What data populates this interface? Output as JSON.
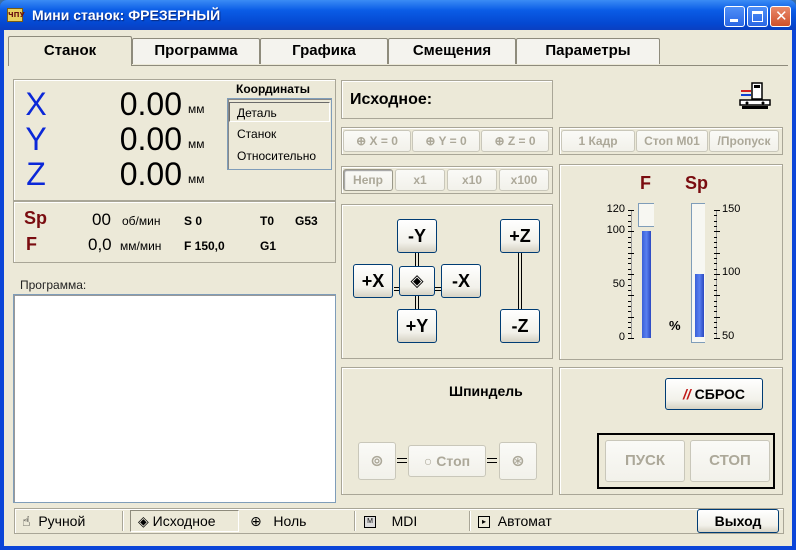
{
  "window": {
    "title": "Мини станок:  ФРЕЗЕРНЫЙ",
    "app_icon_text": "ЧПУ"
  },
  "tabs": [
    "Станок",
    "Программа",
    "Графика",
    "Смещения",
    "Параметры"
  ],
  "coords": {
    "title": "Координаты",
    "axes": [
      {
        "name": "X",
        "value": "0.00",
        "unit": "мм"
      },
      {
        "name": "Y",
        "value": "0.00",
        "unit": "мм"
      },
      {
        "name": "Z",
        "value": "0.00",
        "unit": "мм"
      }
    ],
    "modes": [
      "Деталь",
      "Станок",
      "Относительно"
    ]
  },
  "status": {
    "sp_label": "Sp",
    "sp_value": "00",
    "sp_unit": "об/мин",
    "s_value": "S 0",
    "t_value": "T0",
    "g53": "G53",
    "f_label": "F",
    "f_value": "0,0",
    "f_unit": "мм/мин",
    "f_cmd": "F 150,0",
    "g1": "G1"
  },
  "program": {
    "label": "Программа:"
  },
  "position_state": "Исходное:",
  "zero_buttons": [
    "X = 0",
    "Y = 0",
    "Z = 0"
  ],
  "step_buttons": [
    "Непр",
    "x1",
    "x10",
    "x100"
  ],
  "jog": {
    "plus_x": "+X",
    "minus_x": "-X",
    "plus_y": "+Y",
    "minus_y": "-Y",
    "plus_z": "+Z",
    "minus_z": "-Z"
  },
  "run_options": [
    "1 Кадр",
    "Стоп М01",
    "/Пропуск"
  ],
  "overrides": {
    "feed_label": "F",
    "spindle_label": "Sp",
    "percent": "%",
    "feed_scale": [
      "120",
      "100",
      "50",
      "0"
    ],
    "spindle_scale": [
      "150",
      "100",
      "50"
    ],
    "feed_percent": 100,
    "spindle_percent": 100
  },
  "spindle": {
    "title": "Шпиндель",
    "stop_label": "Стоп"
  },
  "control": {
    "reset": "СБРОС",
    "start": "ПУСК",
    "stop": "СТОП"
  },
  "modes_bar": [
    "Ручной",
    "Исходное",
    "Ноль",
    "MDI",
    "Автомат"
  ],
  "exit": "Выход",
  "colors": {
    "axis_blue": "#0b28d8",
    "dark_red": "#7a0c10",
    "bar_blue": "#3a60d8",
    "title_blue": "#0a5ce6"
  }
}
